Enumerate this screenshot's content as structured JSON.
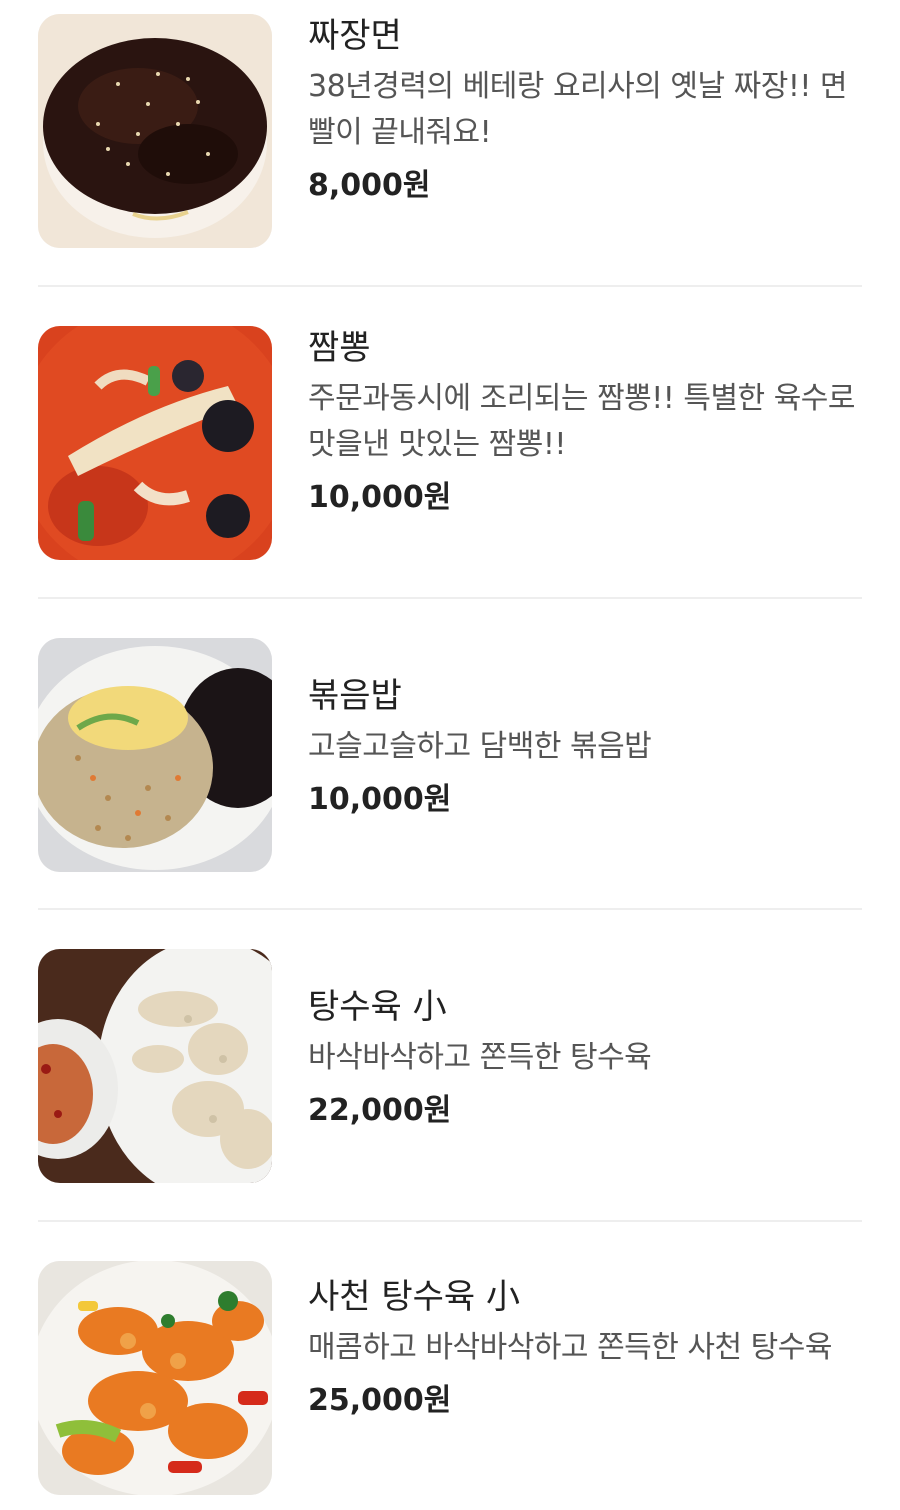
{
  "menu": {
    "items": [
      {
        "name": "짜장면",
        "description": "38년경력의 베테랑 요리사의 옛날 짜장!! 면빨이 끝내줘요!",
        "price": "8,000원",
        "photo": "jjajangmyeon-photo"
      },
      {
        "name": "짬뽕",
        "description": "주문과동시에 조리되는 짬뽕!! 특별한 육수로 맛을낸 맛있는 짬뽕!!",
        "price": "10,000원",
        "photo": "jjamppong-photo"
      },
      {
        "name": "볶음밥",
        "description": "고슬고슬하고 담백한 볶음밥",
        "price": "10,000원",
        "photo": "fried-rice-photo"
      },
      {
        "name": "탕수육 小",
        "description": "바삭바삭하고 쫀득한 탕수육",
        "price": "22,000원",
        "photo": "tangsuyuk-photo"
      },
      {
        "name": "사천 탕수육 小",
        "description": "매콤하고 바삭바삭하고 쫀득한 사천 탕수육",
        "price": "25,000원",
        "photo": "sichuan-tangsuyuk-photo"
      }
    ]
  }
}
